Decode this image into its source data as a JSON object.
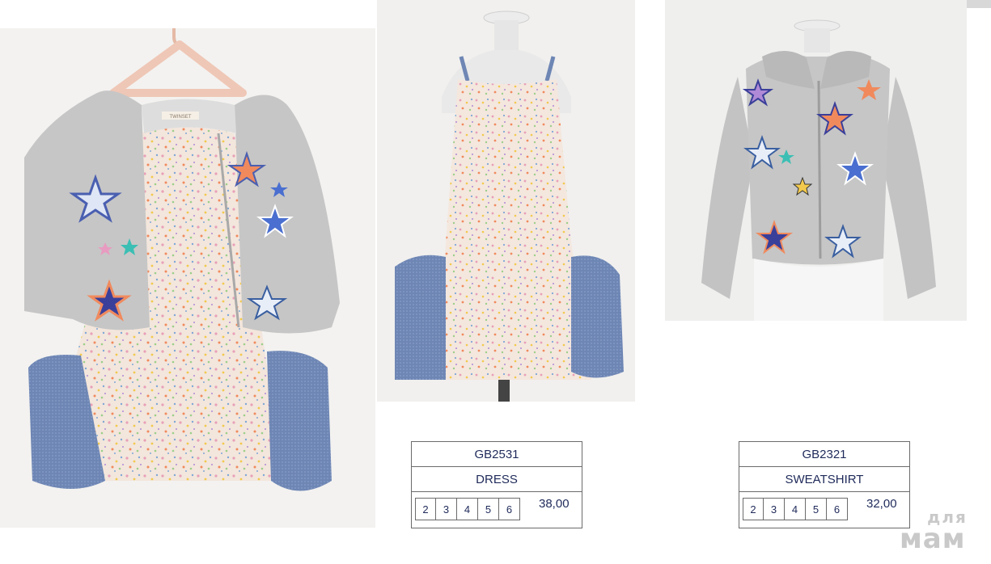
{
  "products": [
    {
      "code": "GB2531",
      "name": "DRESS",
      "sizes": [
        "2",
        "3",
        "4",
        "5",
        "6"
      ],
      "price": "38,00"
    },
    {
      "code": "GB2321",
      "name": "SWEATSHIRT",
      "sizes": [
        "2",
        "3",
        "4",
        "5",
        "6"
      ],
      "price": "32,00"
    }
  ],
  "brand_label": "TWINSET",
  "watermark": {
    "top": "для",
    "bottom": "мам"
  },
  "colors": {
    "text": "#1f2a5a",
    "grid": "#6b6b6b",
    "heather_grey": "#c3c3c3",
    "chambray": "#6e86b4",
    "print_base": "#f3e6dc"
  }
}
